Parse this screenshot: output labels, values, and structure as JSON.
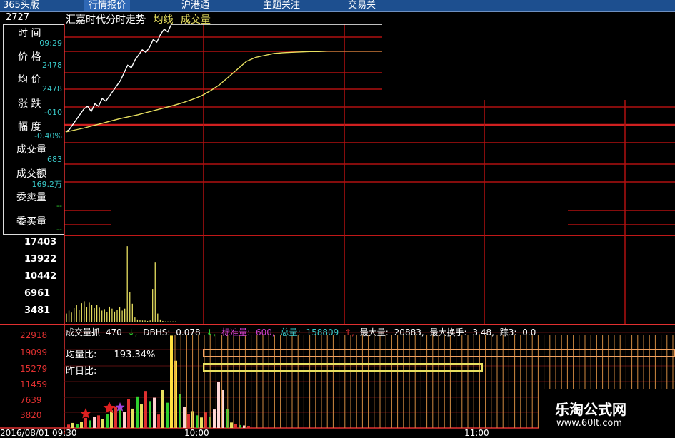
{
  "tabs": [
    {
      "label": "365头版"
    },
    {
      "label": "行情报价"
    },
    {
      "label": "沪港通"
    },
    {
      "label": "主题关注"
    },
    {
      "label": "交易关"
    }
  ],
  "chart_header": {
    "title": "汇嘉时代分时走势",
    "avg_label": "均线",
    "volume_label": "成交量",
    "price_top": "2727"
  },
  "info_panel": {
    "time_label": "时 间",
    "time_value": "09:29",
    "price_label": "价 格",
    "price_value": "2478",
    "avg_label": "均 价",
    "avg_value": "2478",
    "change_label": "涨 跌",
    "change_value": "-010",
    "amp_label": "幅 度",
    "amp_value": "-0.40%",
    "vol_label": "成交量",
    "vol_value": "683",
    "amount_label": "成交额",
    "amount_value": "169.2万",
    "sell_label": "委卖量",
    "sell_value": "--",
    "buy_label": "委买量",
    "buy_value": "--"
  },
  "volume_axis": [
    "17403",
    "13922",
    "10442",
    "6961",
    "3481"
  ],
  "stats_line": {
    "item1_label": "成交量抓",
    "item1_value": "470",
    "item2_label": "DBHS:",
    "item2_value": "0.078",
    "item3_label": "标准量:",
    "item3_value": "600,",
    "item4_label": "总量:",
    "item4_value": "158809",
    "item5_label": "最大量:",
    "item5_value": "20883,",
    "item6_label": "最大换手:",
    "item6_value": "3.48,",
    "item7_label": "踪3:",
    "item7_value": "0.0"
  },
  "indicator_axis": [
    "22918",
    "19099",
    "15279",
    "11459",
    "7639",
    "3820"
  ],
  "ratio": {
    "avg_ratio_label": "均量比:",
    "avg_ratio_value": "193.34%",
    "yesterday_label": "昨日比:"
  },
  "bottom_time": {
    "start": "2016/08/01 09:30",
    "t1": "10:00",
    "t2": "11:00"
  },
  "watermark": {
    "title": "乐淘公式网",
    "url": "www.60lt.com"
  },
  "colors": {
    "grid": "#b01010",
    "price_line": "#ffffff",
    "avg_line": "#e8e060",
    "volume_bar": "#e8e060",
    "topbar": "#1d4f8f"
  },
  "chart_data": [
    {
      "type": "line",
      "title": "汇嘉时代分时走势",
      "series": [
        {
          "name": "价格",
          "values": [
            0,
            1,
            3,
            5,
            7,
            9,
            10,
            8,
            11,
            10,
            13,
            12,
            14,
            16,
            18,
            20,
            23,
            26,
            25,
            28,
            30,
            32,
            31,
            33,
            36,
            35,
            38,
            40,
            39,
            42
          ]
        },
        {
          "name": "均线",
          "values": [
            0,
            0.5,
            1,
            1.6,
            2.2,
            2.8,
            3.4,
            3.9,
            4.4,
            5,
            5.6,
            6.2,
            6.8,
            7.5,
            8.3,
            9.2,
            10.5,
            12,
            14,
            16,
            18,
            19,
            19.5,
            20,
            20.2,
            20.3,
            20.4,
            20.5,
            20.5,
            20.6
          ]
        }
      ]
    },
    {
      "type": "bar",
      "title": "成交量",
      "ylim": [
        0,
        17403
      ],
      "values": [
        1800,
        2400,
        2000,
        2900,
        3600,
        2600,
        3900,
        4300,
        3100,
        4000,
        3500,
        2900,
        3600,
        3000,
        2400,
        2700,
        2100,
        3200,
        2800,
        2200,
        2600,
        3100,
        2400,
        2800,
        15500,
        6200,
        3800,
        1000,
        600,
        500,
        400,
        400,
        300,
        400,
        6800,
        12300,
        1800,
        600,
        300,
        200,
        200,
        200,
        200,
        200,
        100,
        100,
        100,
        100,
        100,
        100,
        100,
        100,
        100,
        100,
        100,
        100,
        100,
        100,
        100,
        100,
        100,
        100,
        100,
        100,
        100,
        100
      ]
    },
    {
      "type": "bar",
      "title": "成交量抓",
      "ylim": [
        0,
        22918
      ],
      "values": [
        800,
        1200,
        900,
        1500,
        2400,
        1800,
        2700,
        3000,
        2200,
        3300,
        4200,
        5000,
        5600,
        3900,
        6800,
        4600,
        7500,
        5600,
        8800,
        6400,
        7200,
        3200,
        9000,
        6000,
        22000,
        16000,
        8000,
        5000,
        3400,
        4000,
        3000,
        2500,
        3700,
        2600,
        4400,
        11000,
        9000,
        4500,
        1300,
        900,
        700,
        600,
        500
      ]
    }
  ]
}
